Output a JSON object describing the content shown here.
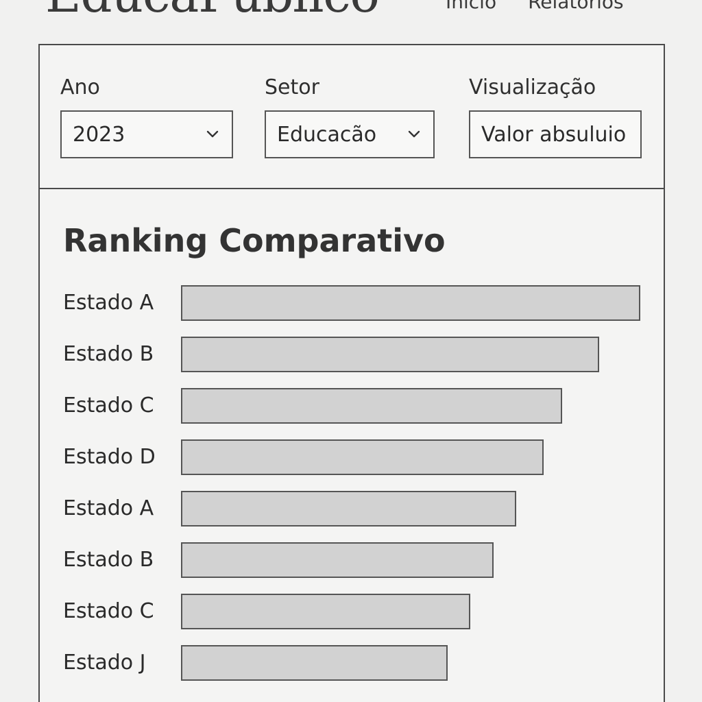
{
  "header": {
    "brand": "EducaPublico",
    "nav": [
      "Inicio",
      "Relatorios"
    ]
  },
  "filters": {
    "ano": {
      "label": "Ano",
      "value": "2023"
    },
    "setor": {
      "label": "Setor",
      "value": "Educacão"
    },
    "visualizacao": {
      "label": "Visualização",
      "value": "Valor absuluio"
    }
  },
  "chart_data": {
    "type": "bar",
    "orientation": "horizontal",
    "title": "Ranking Comparativo",
    "categories": [
      "Estado A",
      "Estado B",
      "Estado C",
      "Estado D",
      "Estado A",
      "Estado B",
      "Estado C",
      "Estado J"
    ],
    "values": [
      100,
      91,
      83,
      79,
      73,
      68,
      63,
      58
    ],
    "xlim": [
      0,
      100
    ],
    "grid": false,
    "bar_color": "#d2d2d2",
    "bar_border": "#555555"
  }
}
